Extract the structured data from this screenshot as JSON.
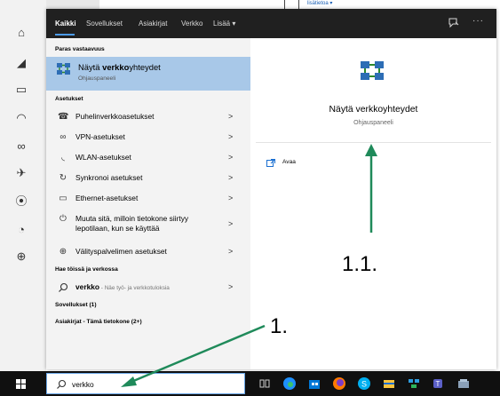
{
  "background": {
    "link_text": "lisätietoa ▾"
  },
  "tabs": [
    {
      "label": "Kaikki"
    },
    {
      "label": "Sovellukset"
    },
    {
      "label": "Asiakirjat"
    },
    {
      "label": "Verkko"
    },
    {
      "label": "Lisää ▾"
    }
  ],
  "header_icons": {
    "feedback": "feedback-icon",
    "more": "···"
  },
  "results": {
    "best_match_header": "Paras vastaavuus",
    "best_match": {
      "title_prefix": "Näytä ",
      "title_highlight": "verkko",
      "title_suffix": "yhteydet",
      "subtitle": "Ohjauspaneeli"
    },
    "settings_header": "Asetukset",
    "settings": [
      {
        "label": "Puhelinverkkoasetukset",
        "icon": "dialup-icon"
      },
      {
        "label": "VPN-asetukset",
        "icon": "vpn-icon"
      },
      {
        "label": "WLAN-asetukset",
        "icon": "wifi-icon"
      },
      {
        "label": "Synkronoi asetukset",
        "icon": "sync-icon"
      },
      {
        "label": "Ethernet-asetukset",
        "icon": "ethernet-icon"
      },
      {
        "label": "Muuta sitä, milloin tietokone siirtyy lepotilaan, kun se käyttää",
        "icon": "power-icon"
      },
      {
        "label": "Välityspalvelimen asetukset",
        "icon": "globe-icon"
      }
    ],
    "web_header": "Hae töissä ja verkossa",
    "web_query": "verkko",
    "web_hint": " - Näe työ- ja verkkotuloksia",
    "apps_header": "Sovellukset (1)",
    "docs_header": "Asiakirjat - Tämä tietokone (2+)"
  },
  "preview": {
    "title": "Näytä verkkoyhteydet",
    "subtitle": "Ohjauspaneeli",
    "open_label": "Avaa"
  },
  "taskbar": {
    "search_text": "verkko",
    "colors": {
      "edge": "#1e90ff",
      "store": "#0078d7",
      "firefox": "#ff7a00",
      "skype": "#00aff0",
      "files": "#f9c440",
      "teams": "#5b5fc7"
    }
  },
  "annotations": {
    "label_1": "1.",
    "label_1_1": "1.1.",
    "arrow_color": "#1f8a5a"
  }
}
